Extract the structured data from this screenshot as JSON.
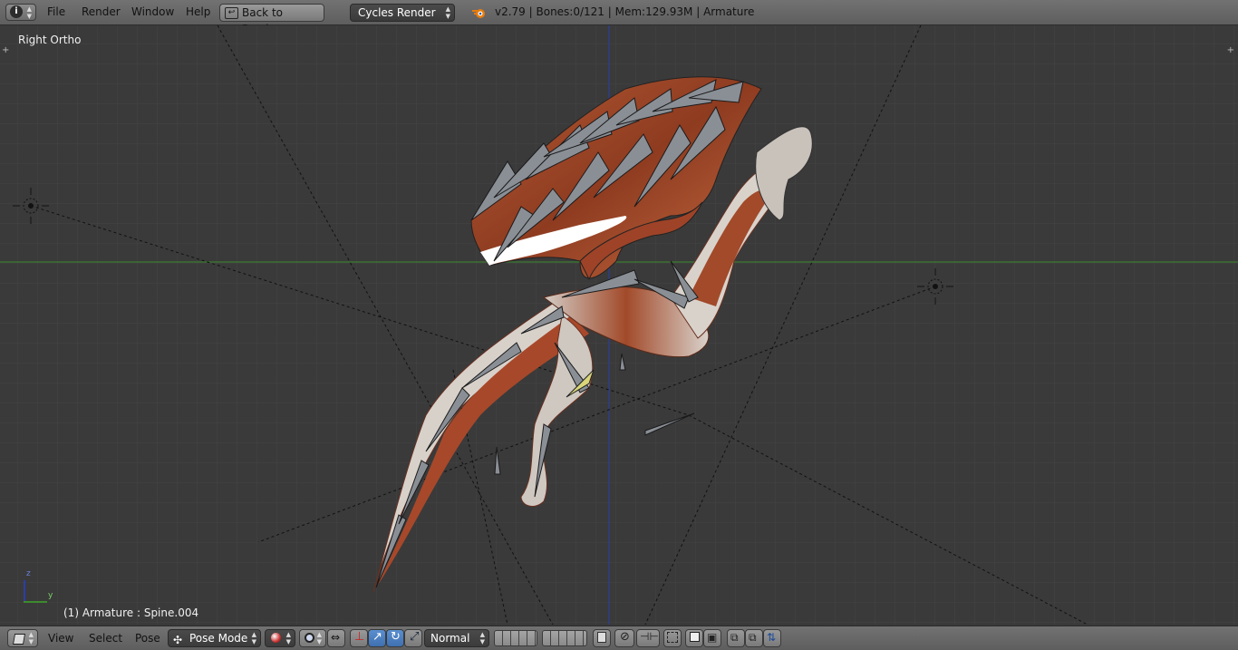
{
  "top_header": {
    "menus": [
      "File",
      "Render",
      "Window",
      "Help"
    ],
    "back_button": "Back to Previous",
    "render_engine": "Cycles Render",
    "stats": "v2.79 | Bones:0/121  | Mem:129.93M | Armature"
  },
  "viewport": {
    "view_label": "Right Ortho",
    "selection_label": "(1) Armature : Spine.004",
    "axis_z": "z",
    "axis_y": "y"
  },
  "bottom_header": {
    "menus": [
      "View",
      "Select",
      "Pose"
    ],
    "mode": "Pose Mode",
    "orientation": "Normal"
  },
  "colors": {
    "header_bg": "#676767",
    "viewport_bg": "#3a3a3a",
    "y_axis_line": "#3d8a2e",
    "z_axis_line": "#2b3ea6",
    "active_button": "#4a7ec2"
  },
  "icons": [
    "info-icon",
    "blender-logo-icon",
    "view3d-editor-icon",
    "pose-mode-icon",
    "viewport-shading-icon",
    "pivot-icon",
    "manipulator-icon",
    "translate-icon",
    "rotate-icon",
    "scale-icon",
    "layers-icon",
    "lock-icon",
    "snap-icon",
    "render-icon",
    "camera-icon",
    "copy-pose-icon",
    "paste-pose-icon",
    "paste-flipped-icon"
  ]
}
